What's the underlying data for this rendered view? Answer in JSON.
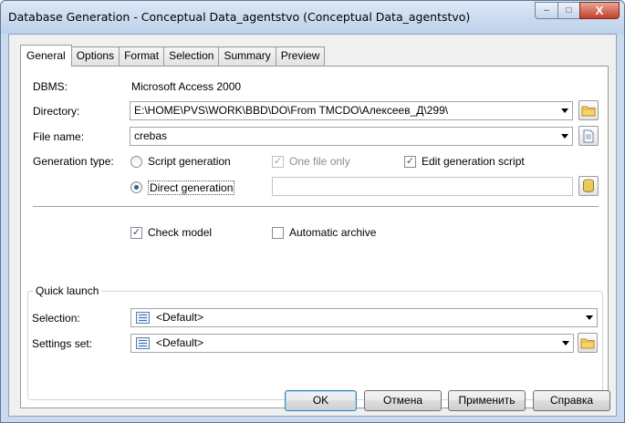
{
  "window": {
    "title": "Database Generation - Conceptual Data_agentstvo (Conceptual Data_agentstvo)",
    "minimize_glyph": "–",
    "maximize_glyph": "□",
    "close_glyph": "X"
  },
  "tabs": [
    "General",
    "Options",
    "Format",
    "Selection",
    "Summary",
    "Preview"
  ],
  "active_tab": "General",
  "general": {
    "dbms_label": "DBMS:",
    "dbms_value": "Microsoft Access 2000",
    "directory_label": "Directory:",
    "directory_value": "E:\\HOME\\PVS\\WORK\\BBD\\DO\\From TMCDO\\Алексеев_Д\\299\\",
    "filename_label": "File name:",
    "filename_value": "crebas",
    "gentype_label": "Generation type:",
    "script_generation": "Script generation",
    "one_file_only": "One file only",
    "edit_generation_script": "Edit generation script",
    "direct_generation": "Direct generation",
    "check_model": "Check model",
    "automatic_archive": "Automatic archive"
  },
  "quick_launch": {
    "title": "Quick launch",
    "selection_label": "Selection:",
    "selection_value": "<Default>",
    "settings_label": "Settings set:",
    "settings_value": "<Default>"
  },
  "buttons": {
    "ok": "OK",
    "cancel": "Отмена",
    "apply": "Применить",
    "help": "Справка"
  },
  "state": {
    "script_generation_selected": false,
    "direct_generation_selected": true,
    "one_file_only_checked": true,
    "one_file_only_enabled": false,
    "edit_generation_script_checked": true,
    "check_model_checked": true,
    "automatic_archive_checked": false
  },
  "icons": [
    "folder-icon",
    "document-icon",
    "database-icon",
    "list-icon",
    "settings-list-icon"
  ],
  "colors": {
    "accent": "#3c7fb1",
    "titlebar": "#c9d9ee",
    "close": "#c3402b"
  }
}
